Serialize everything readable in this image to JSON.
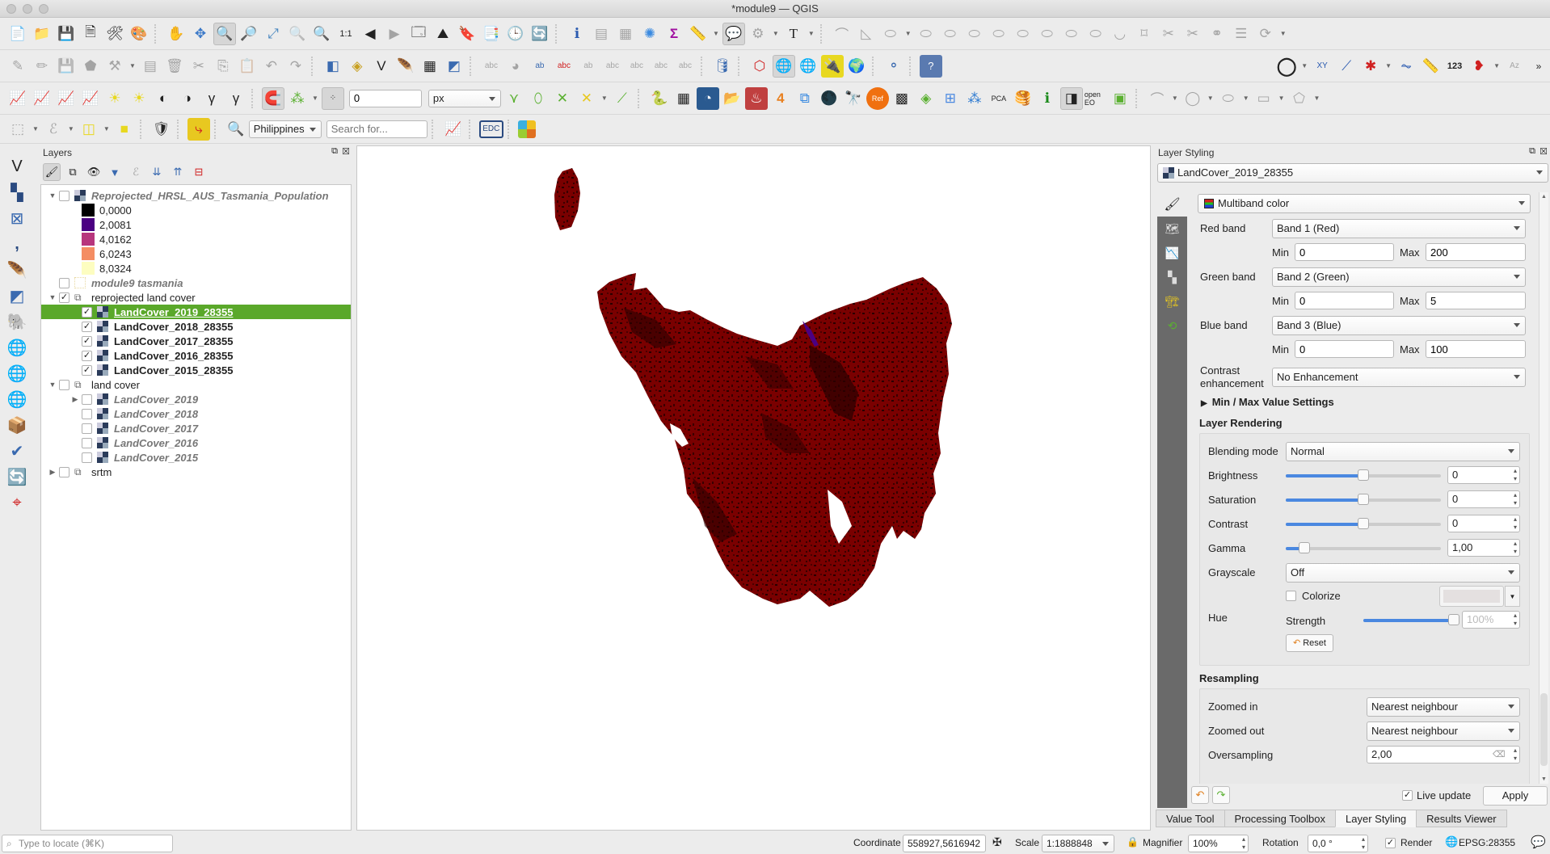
{
  "window": {
    "title": "*module9 — QGIS"
  },
  "toolbar": {
    "row1_icons": [
      "new-project-icon",
      "open-project-icon",
      "save-project-icon",
      "new-print-layout-icon",
      "layout-manager-icon",
      "style-manager-icon",
      "pan-icon",
      "pan-to-selection-icon",
      "zoom-in-icon",
      "zoom-out-icon",
      "zoom-full-icon",
      "zoom-to-selection-icon",
      "zoom-to-layer-icon",
      "zoom-native-icon",
      "zoom-last-icon",
      "zoom-next-icon",
      "new-map-view-icon",
      "new-3d-view-icon",
      "new-bookmark-icon",
      "show-bookmarks-icon",
      "temporal-controller-icon",
      "refresh-icon",
      "identify-icon",
      "attribute-table-icon",
      "statistics-icon",
      "processing-toolbox-icon",
      "field-calculator-icon",
      "measure-icon",
      "map-tips-icon",
      "annotation-icon",
      "text-annotation-icon"
    ],
    "snapping_tolerance": "0",
    "snapping_unit": "px",
    "locator_country": "Philippines",
    "search_placeholder": "Search for...",
    "edc_label": "EDC",
    "right_label_123": "123"
  },
  "layers_panel": {
    "title": "Layers",
    "items": [
      {
        "name": "Reprojected_HRSL_AUS_Tasmania_Population",
        "checked": false,
        "expanded": true,
        "style": "italic-grey"
      },
      {
        "legend": "0,0000",
        "color": "#000000"
      },
      {
        "legend": "2,0081",
        "color": "#4b0082"
      },
      {
        "legend": "4,0162",
        "color": "#b7367d"
      },
      {
        "legend": "6,0243",
        "color": "#f48d63"
      },
      {
        "legend": "8,0324",
        "color": "#fdfdc0"
      },
      {
        "name": "module9 tasmania",
        "checked": false,
        "style": "italic-grey"
      },
      {
        "name": "reprojected land cover",
        "checked": true,
        "expanded": true,
        "group": true
      },
      {
        "name": "LandCover_2019_28355",
        "checked": true,
        "selected": true
      },
      {
        "name": "LandCover_2018_28355",
        "checked": true
      },
      {
        "name": "LandCover_2017_28355",
        "checked": true
      },
      {
        "name": "LandCover_2016_28355",
        "checked": true
      },
      {
        "name": "LandCover_2015_28355",
        "checked": true
      },
      {
        "name": "land cover",
        "checked": false,
        "expanded": true,
        "group": true
      },
      {
        "name": "LandCover_2019",
        "checked": false,
        "style": "italic-grey",
        "collapsed": true
      },
      {
        "name": "LandCover_2018",
        "checked": false,
        "style": "italic-grey"
      },
      {
        "name": "LandCover_2017",
        "checked": false,
        "style": "italic-grey"
      },
      {
        "name": "LandCover_2016",
        "checked": false,
        "style": "italic-grey"
      },
      {
        "name": "LandCover_2015",
        "checked": false,
        "style": "italic-grey"
      },
      {
        "name": "srtm",
        "checked": false,
        "group": true,
        "collapsed": true
      }
    ]
  },
  "map": {
    "land_color": "#7a0000",
    "dark_color": "#2a0000",
    "water_color": "#4b0082"
  },
  "styling": {
    "title": "Layer Styling",
    "layer": "LandCover_2019_28355",
    "renderer": "Multiband color",
    "red_band": {
      "label": "Red band",
      "value": "Band 1 (Red)",
      "min": "0",
      "max": "200"
    },
    "green_band": {
      "label": "Green band",
      "value": "Band 2 (Green)",
      "min": "0",
      "max": "5"
    },
    "blue_band": {
      "label": "Blue band",
      "value": "Band 3 (Blue)",
      "min": "0",
      "max": "100"
    },
    "min_label": "Min",
    "max_label": "Max",
    "contrast_label_1": "Contrast",
    "contrast_label_2": "enhancement",
    "contrast_value": "No Enhancement",
    "minmax_settings": "Min / Max Value Settings",
    "rendering": {
      "title": "Layer Rendering",
      "blending_label": "Blending mode",
      "blending_value": "Normal",
      "brightness_label": "Brightness",
      "brightness": "0",
      "brightness_pos": 0.5,
      "saturation_label": "Saturation",
      "saturation": "0",
      "saturation_pos": 0.5,
      "contrast_label": "Contrast",
      "contrast": "0",
      "contrast_pos": 0.5,
      "gamma_label": "Gamma",
      "gamma": "1,00",
      "gamma_pos": 0.12,
      "grayscale_label": "Grayscale",
      "grayscale_value": "Off",
      "hue_label": "Hue",
      "colorize_label": "Colorize",
      "colorize_checked": false,
      "strength_label": "Strength",
      "strength": "100%",
      "strength_pos": 1.0,
      "reset_label": "Reset"
    },
    "resampling": {
      "title": "Resampling",
      "zoomed_in_label": "Zoomed in",
      "zoomed_in": "Nearest neighbour",
      "zoomed_out_label": "Zoomed out",
      "zoomed_out": "Nearest neighbour",
      "oversampling_label": "Oversampling",
      "oversampling": "2,00"
    },
    "live_update_label": "Live update",
    "live_update_checked": true,
    "apply_label": "Apply"
  },
  "bottom_tabs": [
    "Value Tool",
    "Processing Toolbox",
    "Layer Styling",
    "Results Viewer"
  ],
  "bottom_tabs_selected": "Layer Styling",
  "statusbar": {
    "locator_placeholder": "Type to locate (⌘K)",
    "coordinate_label": "Coordinate",
    "coordinate": "558927,5616942",
    "scale_label": "Scale",
    "scale": "1:1888848",
    "magnifier_label": "Magnifier",
    "magnifier": "100%",
    "rotation_label": "Rotation",
    "rotation": "0,0 °",
    "render_label": "Render",
    "render_checked": true,
    "crs": "EPSG:28355"
  }
}
